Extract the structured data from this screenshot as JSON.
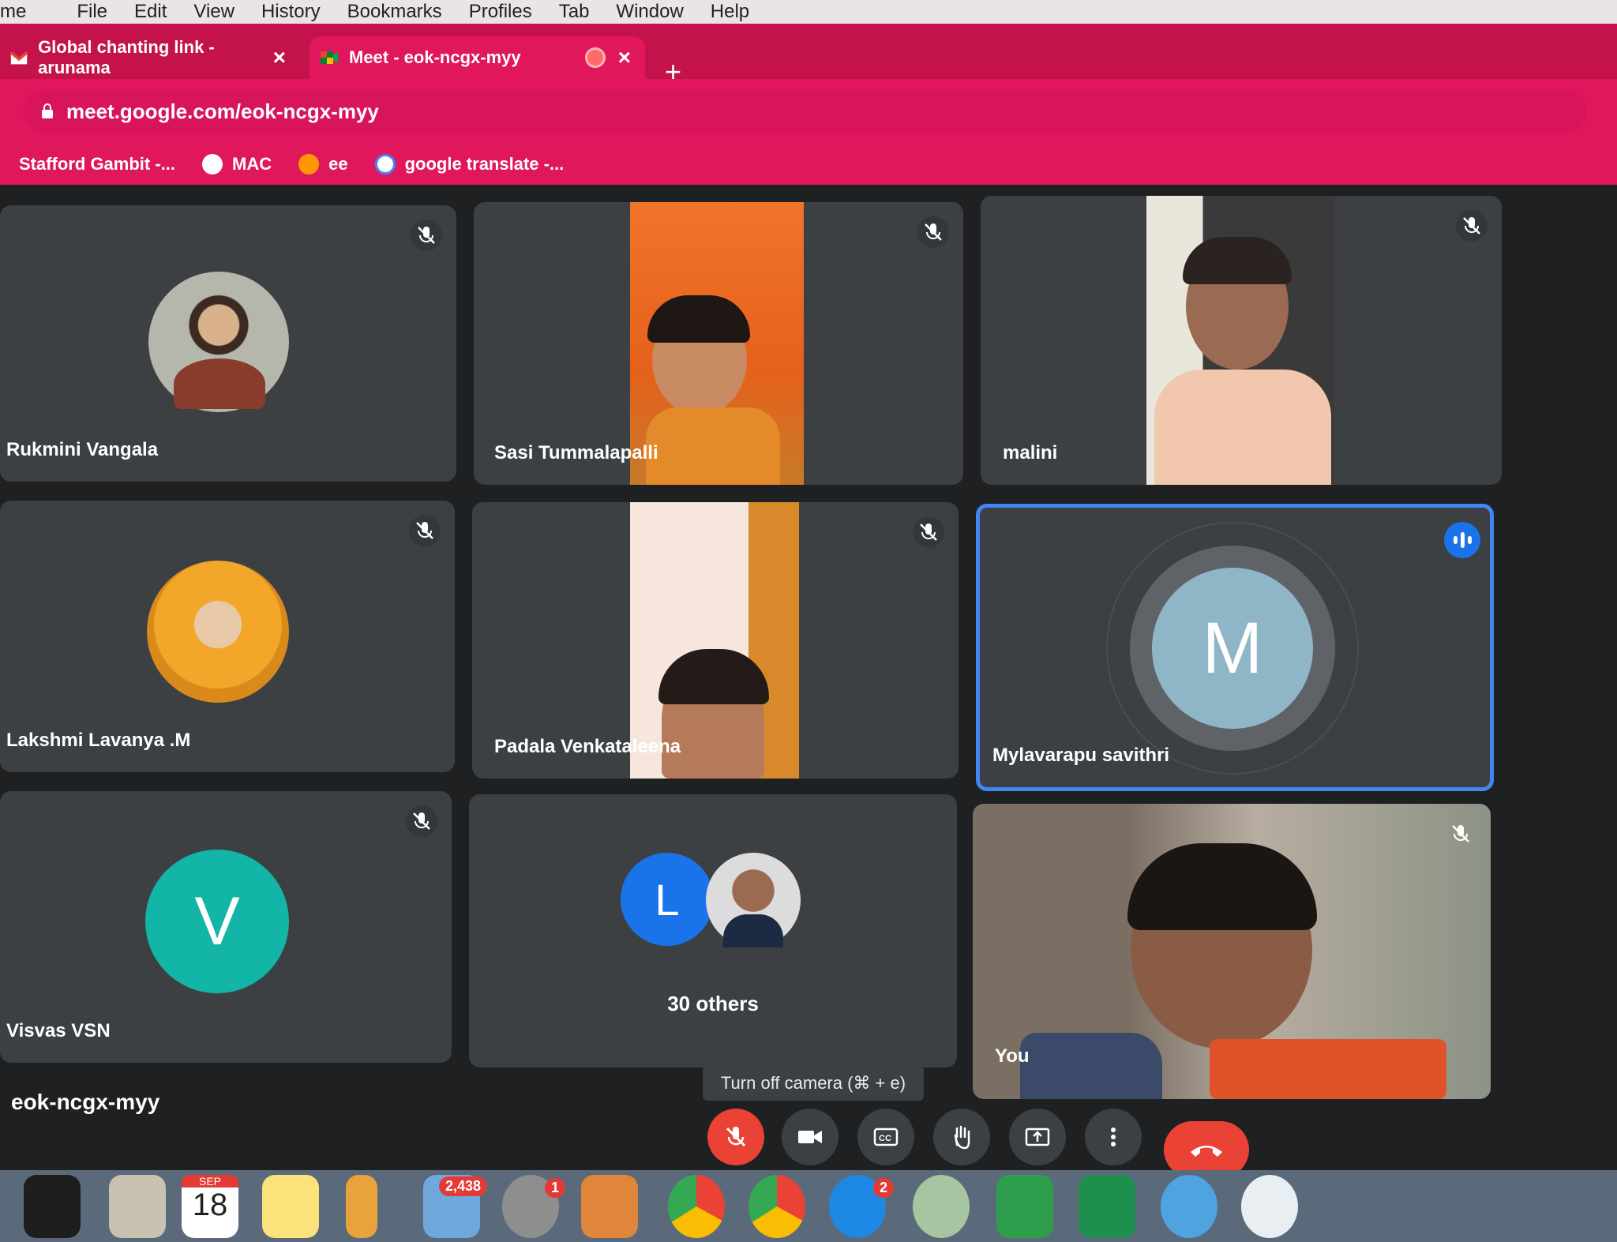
{
  "menubar": {
    "items": [
      "me",
      "File",
      "Edit",
      "View",
      "History",
      "Bookmarks",
      "Profiles",
      "Tab",
      "Window",
      "Help"
    ]
  },
  "tabs": [
    {
      "label": "Global chanting link - arunama",
      "close": "×"
    },
    {
      "label": "Meet - eok-ncgx-myy",
      "close": "×"
    }
  ],
  "newtab_label": "+",
  "address": {
    "url": "meet.google.com/eok-ncgx-myy"
  },
  "bookmarks": [
    {
      "label": "Stafford Gambit -..."
    },
    {
      "label": "MAC"
    },
    {
      "label": "ee"
    },
    {
      "label": "google translate -..."
    }
  ],
  "participants": {
    "rukmini": "Rukmini Vangala",
    "sasi": "Sasi Tummalapalli",
    "malini": "malini",
    "lakshmi": "Lakshmi Lavanya .M",
    "padala": "Padala Venkataleena",
    "mylavarapu": "Mylavarapu savithri",
    "mylavarapu_initial": "M",
    "visvas": "Visvas VSN",
    "visvas_initial": "V",
    "others_initial": "L",
    "others_label": "30 others",
    "you": "You"
  },
  "meeting_code": "eok-ncgx-myy",
  "tooltip": "Turn off camera (⌘ + e)",
  "dock": {
    "calendar_month": "SEP",
    "calendar_day": "18",
    "badge_mail": "2,438",
    "badge_settings": "1",
    "badge_appstore": "2"
  },
  "colors": {
    "browser_accent": "#e0175c",
    "tile_bg": "#3c4043",
    "active_speaker_border": "#4285f4",
    "avatar_m": "#8fb6c6",
    "avatar_v": "#12b5a6",
    "avatar_l": "#1a73e8",
    "leave_red": "#ea4335"
  }
}
